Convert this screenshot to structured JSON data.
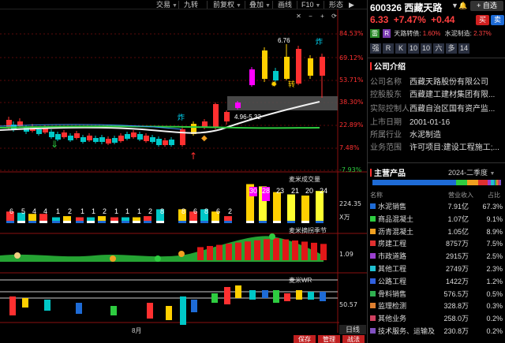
{
  "toolbar": {
    "items": [
      "交易",
      "九转",
      "前复权",
      "叠加",
      "画线",
      "F10",
      "形态"
    ],
    "icons": [
      "plus-icon",
      "minus-icon",
      "bell-icon"
    ]
  },
  "stock": {
    "code": "600326",
    "name": "西藏天路",
    "price": "6.33",
    "change_pct": "+7.47%",
    "change": "+0.44",
    "buy_label": "买",
    "sell_label": "卖",
    "add_label": "+ 自选",
    "tag_green": "雷",
    "tag_purple": "R",
    "tag_text": "天路转债:",
    "tag_val": "1.60%",
    "tag2_text": "水泥制造:",
    "tag2_val": "2.37%",
    "small_buttons": [
      "强",
      "R",
      "K",
      "10",
      "10",
      "六",
      "多",
      "14"
    ]
  },
  "price_axis": [
    "84.53%",
    "69.12%",
    "53.71%",
    "38.30%",
    "22.89%",
    "7.48%",
    "-7.93%"
  ],
  "annotations": {
    "high": "6.76",
    "range": "4.96-5.32",
    "zha1": "炸",
    "zha2": "炸",
    "zhuan": "转"
  },
  "volume_panel": {
    "title": "麦米成交量",
    "axis_value": "224.35",
    "axis_unit": "X万",
    "labels": [
      "6",
      "5",
      "4",
      "4",
      "1",
      "2",
      "1",
      "1",
      "2",
      "1",
      "1",
      "1",
      "2",
      "8",
      "8",
      "6",
      "8",
      "6",
      "2",
      "30",
      "28",
      "23",
      "21",
      "20",
      "24"
    ]
  },
  "season_panel": {
    "title": "麦米摘拐季节",
    "axis_value": "1.09"
  },
  "wr_panel": {
    "title": "麦米WR",
    "axis_value": "50.57"
  },
  "bottom": {
    "month": "8月",
    "period": "日线",
    "save": "保存",
    "manage": "管理",
    "tactics": "战法"
  },
  "company": {
    "title": "公司介绍",
    "rows": [
      {
        "k": "公司名称",
        "v": "西藏天路股份有限公司"
      },
      {
        "k": "控股股东",
        "v": "西藏建工建材集团有限..."
      },
      {
        "k": "实际控制人",
        "v": "西藏自治区国有资产监..."
      },
      {
        "k": "上市日期",
        "v": "2001-01-16"
      },
      {
        "k": "所属行业",
        "v": "水泥制造"
      },
      {
        "k": "业务范围",
        "v": "许可项目:建设工程施工;..."
      }
    ]
  },
  "business": {
    "title": "主营产品",
    "period": "2024-二季度",
    "headers": {
      "name": "名称",
      "rev": "营业收入",
      "pct": "占比"
    },
    "rows": [
      {
        "name": "水泥销售",
        "rev": "7.91亿",
        "pct": "67.3%",
        "color": "#1e6bd6"
      },
      {
        "name": "商品混凝土",
        "rev": "1.07亿",
        "pct": "9.1%",
        "color": "#2ecc40"
      },
      {
        "name": "沥青混凝土",
        "rev": "1.05亿",
        "pct": "8.9%",
        "color": "#f0a020"
      },
      {
        "name": "房建工程",
        "rev": "8757万",
        "pct": "7.5%",
        "color": "#e03030"
      },
      {
        "name": "市政道路",
        "rev": "2915万",
        "pct": "2.5%",
        "color": "#9b40d0"
      },
      {
        "name": "其他工程",
        "rev": "2749万",
        "pct": "2.3%",
        "color": "#20c0d0"
      },
      {
        "name": "公路工程",
        "rev": "1422万",
        "pct": "1.2%",
        "color": "#3060e0"
      },
      {
        "name": "骨料销售",
        "rev": "576.5万",
        "pct": "0.5%",
        "color": "#30b050"
      },
      {
        "name": "监理检测",
        "rev": "328.8万",
        "pct": "0.3%",
        "color": "#e08030"
      },
      {
        "name": "其他业务",
        "rev": "258.0万",
        "pct": "0.2%",
        "color": "#d04060"
      },
      {
        "name": "技术服务、运输及",
        "rev": "230.8万",
        "pct": "0.2%",
        "color": "#8050c0"
      }
    ]
  },
  "colors": {
    "up": "#ff3030",
    "down": "#00c8c8",
    "accent": "#ff4040",
    "bg": "#000000"
  }
}
